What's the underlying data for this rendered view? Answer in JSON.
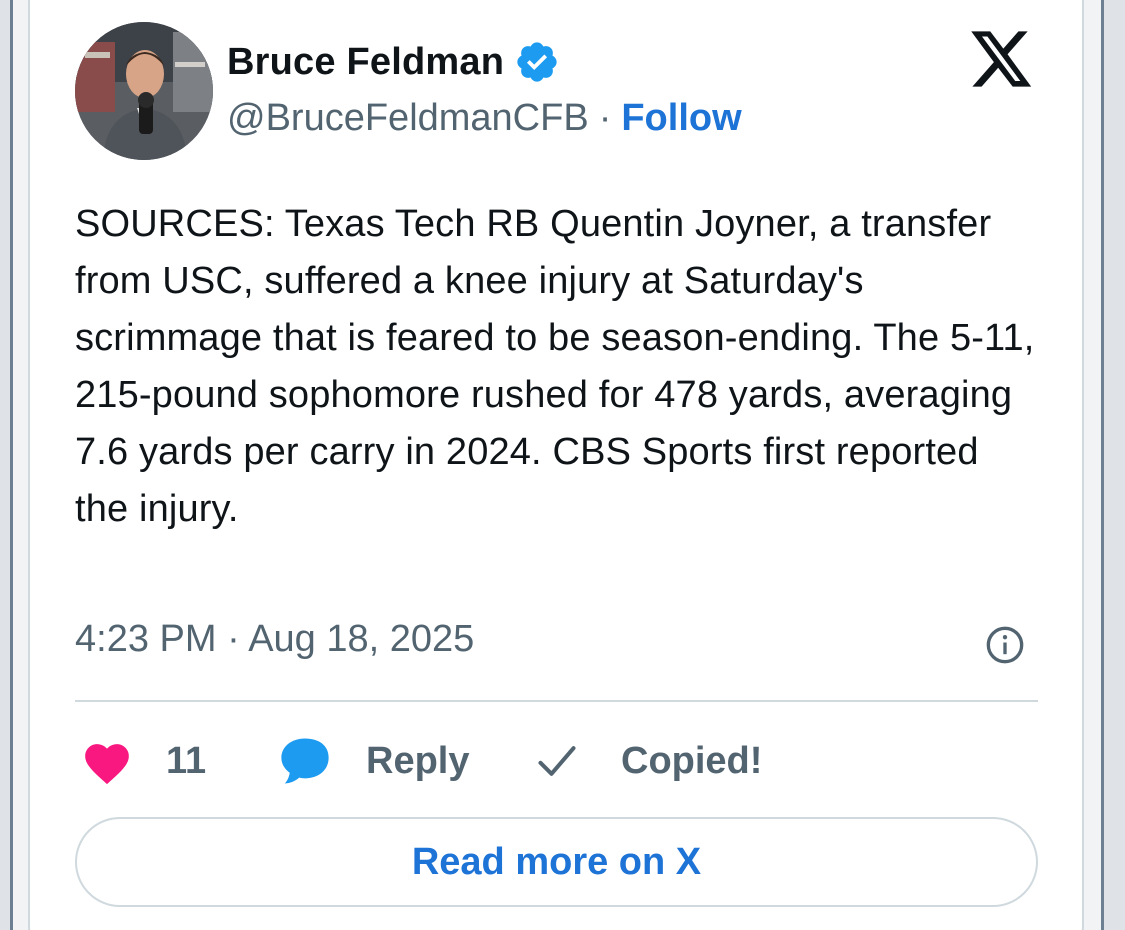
{
  "author": {
    "name": "Bruce Feldman",
    "handle": "@BruceFeldmanCFB",
    "separator": "·",
    "follow_label": "Follow",
    "verified": true,
    "verified_color": "#1d9bf0"
  },
  "tweet": {
    "text": "SOURCES: Texas Tech RB Quentin Joyner, a transfer from USC, suffered a knee injury at Saturday's scrimmage that is feared to be season-ending. The 5-11, 215-pound sophomore rushed for 478 yards, averaging 7.6 yards per carry in 2024. CBS Sports first reported the injury.",
    "timestamp": "4:23 PM · Aug 18, 2025"
  },
  "actions": {
    "like_count": "11",
    "reply_label": "Reply",
    "copy_label": "Copied!",
    "like_color": "#f91880",
    "reply_color": "#1d9bf0"
  },
  "footer": {
    "read_more_label": "Read more on X"
  },
  "icons": {
    "brand": "x-logo-icon",
    "verified": "verified-badge-icon",
    "info": "info-icon",
    "like": "heart-icon",
    "reply": "speech-bubble-icon",
    "copy": "checkmark-icon"
  }
}
